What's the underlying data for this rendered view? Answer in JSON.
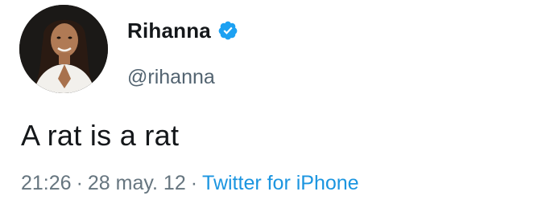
{
  "tweet": {
    "author": {
      "name": "Rihanna",
      "handle": "@rihanna",
      "verified": true,
      "avatar_icon": "profile-photo"
    },
    "text": "A rat is a rat",
    "meta": {
      "time": "21:26",
      "separator": "·",
      "date": "28 may. 12",
      "source": "Twitter for iPhone"
    }
  },
  "colors": {
    "verified_badge": "#1da1f2",
    "source_link": "#1b95e0",
    "secondary_text": "#66757f"
  }
}
